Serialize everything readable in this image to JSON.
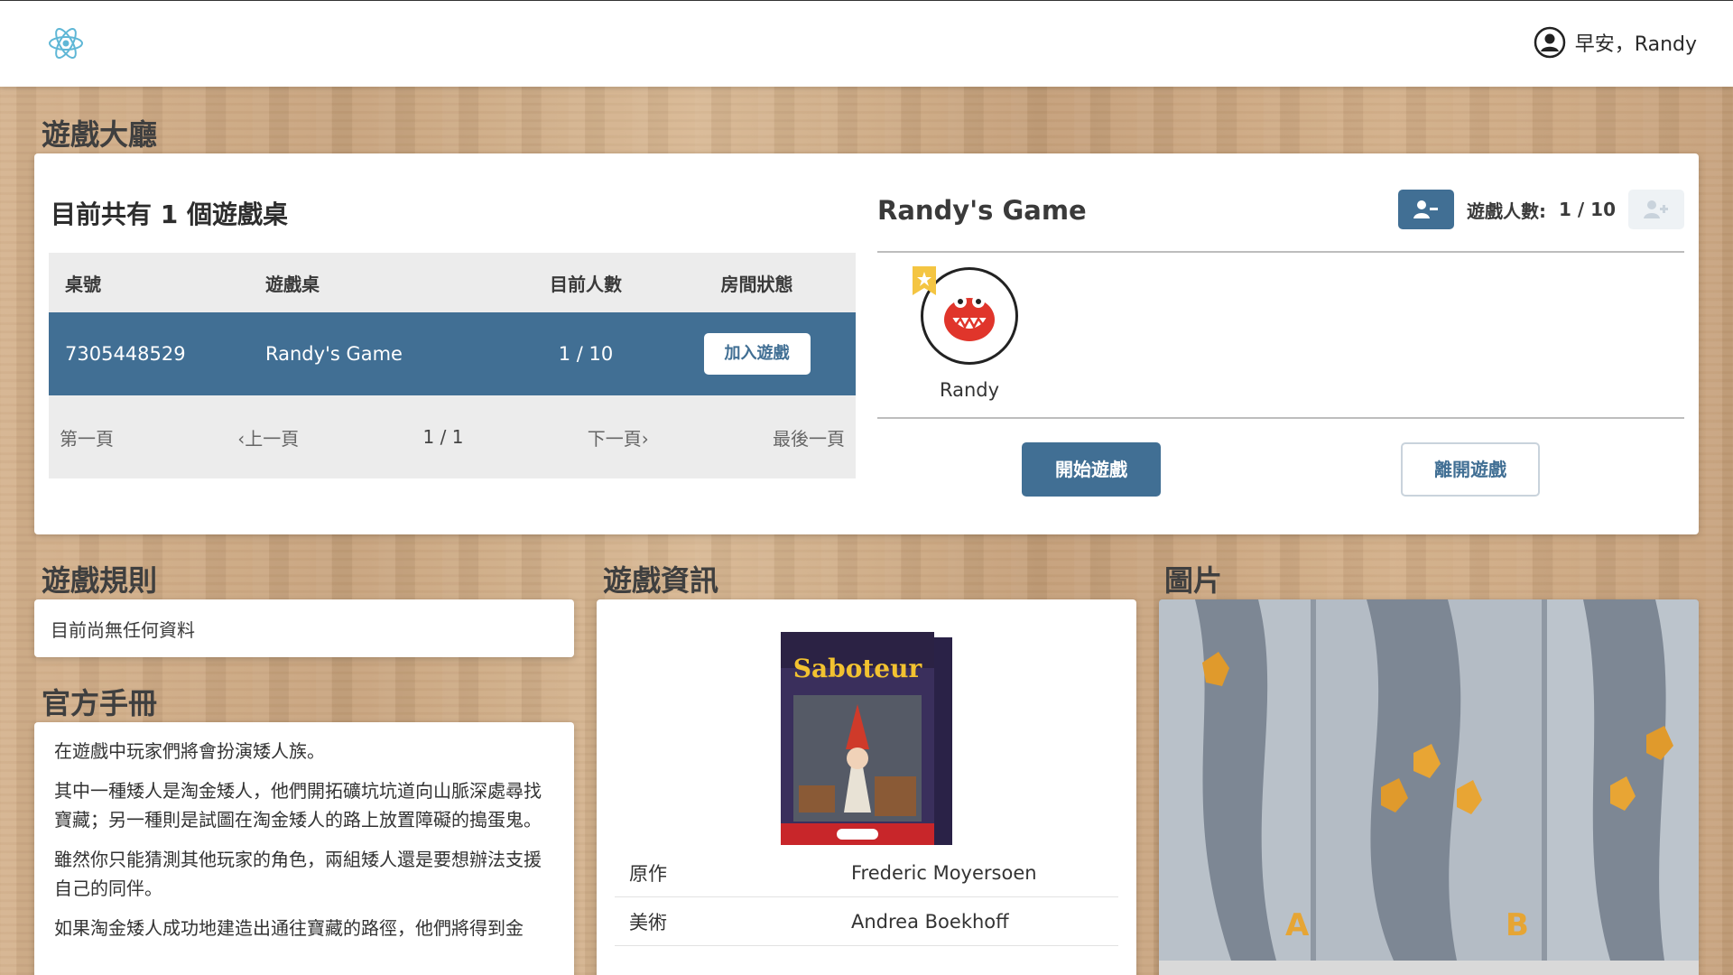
{
  "header": {
    "logo_icon": "react-atom-icon",
    "greeting": "早安，Randy",
    "user_icon": "user-circle-icon"
  },
  "lobby": {
    "section_title": "遊戲大廳",
    "tables_title": "目前共有 1 個遊戲桌",
    "columns": [
      "桌號",
      "遊戲桌",
      "目前人數",
      "房間狀態"
    ],
    "rows": [
      {
        "id": "7305448529",
        "name": "Randy's Game",
        "players": "1 / 10",
        "action_label": "加入遊戲"
      }
    ],
    "pagination": {
      "first": "第一頁",
      "prev": "上一頁",
      "current": "1 / 1",
      "next": "下一頁",
      "last": "最後一頁"
    }
  },
  "room": {
    "title": "Randy's Game",
    "player_count_label": "遊戲人數:",
    "player_count": "1 / 10",
    "remove_player_icon": "user-minus-icon",
    "add_player_icon": "user-plus-icon",
    "players": [
      {
        "name": "Randy",
        "is_host": true
      }
    ],
    "start_label": "開始遊戲",
    "leave_label": "離開遊戲"
  },
  "rules": {
    "section_title": "遊戲規則",
    "empty_text": "目前尚無任何資料"
  },
  "manual": {
    "section_title": "官方手冊",
    "paragraphs": [
      "在遊戲中玩家們將會扮演矮人族。",
      "其中一種矮人是淘金矮人，他們開拓礦坑坑道向山脈深處尋找寶藏；另一種則是試圖在淘金矮人的路上放置障礙的搗蛋鬼。",
      "雖然你只能猜測其他玩家的角色，兩組矮人還是要想辦法支援自己的同伴。",
      "如果淘金矮人成功地建造出通往寶藏的路徑，他們將得到金"
    ]
  },
  "info": {
    "section_title": "遊戲資訊",
    "box_title": "Saboteur",
    "rows": [
      {
        "label": "原作",
        "value": "Frederic Moyersoen"
      },
      {
        "label": "美術",
        "value": "Andrea Boekhoff"
      }
    ]
  },
  "images": {
    "section_title": "圖片",
    "letters": [
      "A",
      "B"
    ]
  },
  "colors": {
    "primary": "#416f94",
    "wood": "#c9a57f"
  }
}
